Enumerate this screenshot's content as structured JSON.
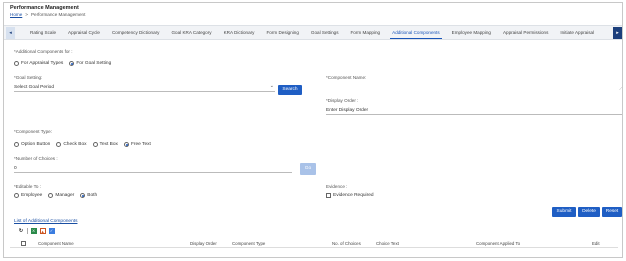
{
  "header": {
    "title": "Performance Management",
    "breadcrumb": {
      "home": "Home",
      "separator": ">",
      "current": "Performance Management"
    }
  },
  "tabs": [
    "Rating Scale",
    "Appraisal Cycle",
    "Competency Dictionary",
    "Goal KRA Category",
    "KRA Dictionary",
    "Form Designing",
    "Goal Settings",
    "Form Mapping",
    "Additional Components",
    "Employee Mapping",
    "Appraisal Permissions",
    "Initiate Appraisal"
  ],
  "active_tab": "Additional Components",
  "form": {
    "additional_for_label": "*Additional Components for :",
    "additional_for_options": [
      "For Appraisal Types",
      "For Goal Setting"
    ],
    "additional_for_selected": "For Goal Setting",
    "goal_setting_label": "*Goal Setting:",
    "goal_setting_value": "Select Goal Period",
    "search_button": "Search",
    "component_name_label": "*Component Name:",
    "component_name_value": "",
    "display_order_label": "*Display Order :",
    "display_order_value": "Enter Display Order",
    "component_type_label": "*Component Type:",
    "component_type_options": [
      "Option Button",
      "Check Box",
      "Text Box",
      "Free Text"
    ],
    "component_type_selected": "Free Text",
    "num_choices_label": "*Number of Choices :",
    "num_choices_value": "0",
    "go_button": "Go",
    "editable_to_label": "*Editable To :",
    "editable_to_options": [
      "Employee",
      "Manager",
      "Both"
    ],
    "editable_to_selected": "Both",
    "evidence_label": "Evidence :",
    "evidence_checkbox": "Evidence Required"
  },
  "actions": {
    "submit": "Submit",
    "delete": "Delete",
    "reset": "Reset"
  },
  "list": {
    "title": "List of Additional Components",
    "columns": [
      "Component Name",
      "Display Order",
      "Component Type",
      "No. of Choices",
      "Choice Text",
      "Component Applied To",
      "Edit"
    ]
  }
}
